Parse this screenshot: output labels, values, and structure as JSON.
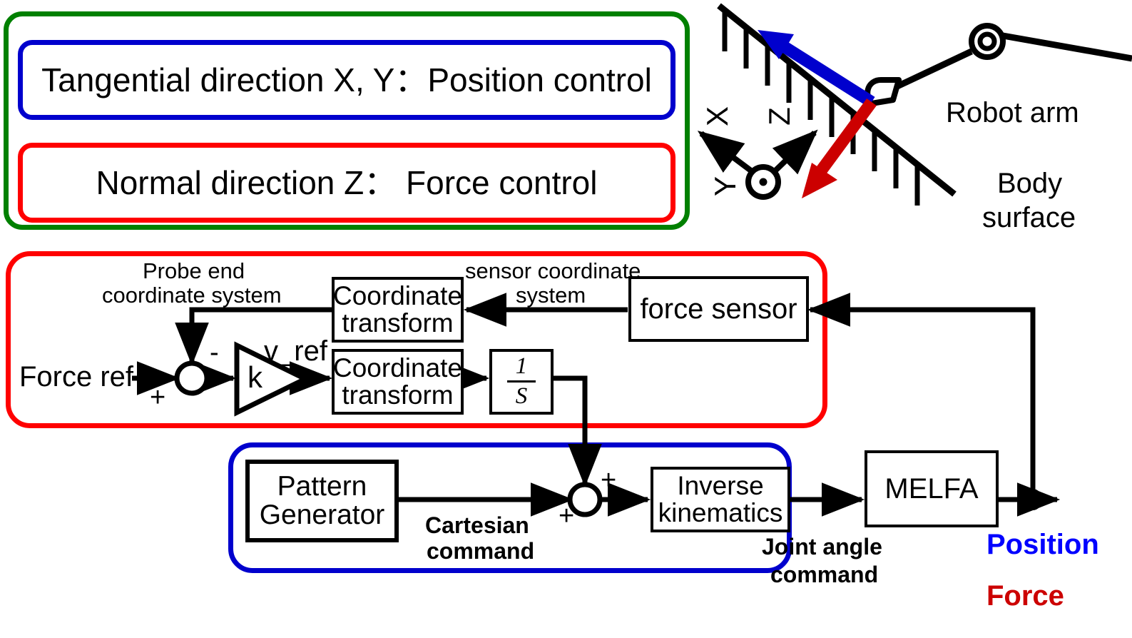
{
  "legend": {
    "outer_border_color": "#008000",
    "tangential": {
      "text": "Tangential direction X, Y：Position control",
      "border_color": "#0000CD"
    },
    "normal": {
      "text": "Normal direction Z： Force control",
      "border_color": "#FF0000"
    }
  },
  "scene": {
    "robot_arm_label": "Robot arm",
    "body_surface_label": "Body\nsurface",
    "body_surface_line1": "Body",
    "body_surface_line2": "surface",
    "axes": {
      "x_label": "X",
      "y_label": "Y",
      "z_label": "Z"
    },
    "arrow_normal_color": "#0000CD",
    "arrow_force_color": "#CC0000"
  },
  "force_loop": {
    "border_color": "#FF0000",
    "input_label": "Force ref",
    "sum_plus": "+",
    "sum_minus": "-",
    "gain_label": "k",
    "gain_output_label": "v_ref",
    "probe_label_line1": "Probe end",
    "probe_label_line2": "coordinate system",
    "sensor_label_line1": "sensor coordinate",
    "sensor_label_line2": "system",
    "coord_transform_top": [
      "Coordinate",
      "transform"
    ],
    "coord_transform_bottom": [
      "Coordinate",
      "transform"
    ],
    "integrator_numerator": "1",
    "integrator_denominator": "S",
    "force_sensor_label": "force sensor"
  },
  "position_loop": {
    "border_color": "#0000CD",
    "pattern_generator": [
      "Pattern",
      "Generator"
    ],
    "cartesian_command_line1": "Cartesian",
    "cartesian_command_line2": "command",
    "sum_plus_top": "+",
    "sum_plus_bottom": "+",
    "inverse_kinematics": [
      "Inverse",
      "kinematics"
    ],
    "joint_angle_line1": "Joint angle",
    "joint_angle_line2": "command"
  },
  "plant": {
    "melfa_label": "MELFA"
  },
  "outputs": {
    "position_label": "Position",
    "position_color": "#0000FF",
    "force_label": "Force",
    "force_color": "#CC0000"
  }
}
